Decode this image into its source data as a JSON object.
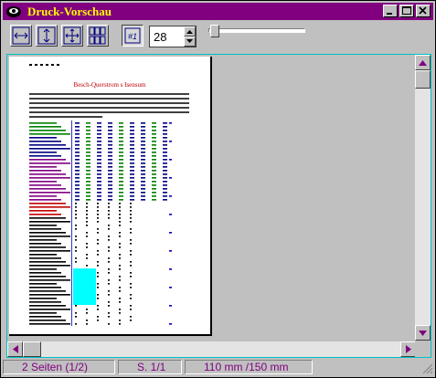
{
  "window": {
    "title": "Druck-Vorschau",
    "minimize": "_",
    "maximize": "□",
    "close": "✕"
  },
  "toolbar": {
    "buttons": [
      {
        "name": "fit-width-button",
        "icon": "fit-width-icon"
      },
      {
        "name": "fit-height-button",
        "icon": "fit-height-icon"
      },
      {
        "name": "fit-page-button",
        "icon": "fit-page-icon"
      },
      {
        "name": "multi-page-button",
        "icon": "grid-pages-icon"
      },
      {
        "name": "page-number-button",
        "icon": "page-number-icon",
        "label": "#1"
      }
    ],
    "zoom_value": "28",
    "slider_fraction": 0.05
  },
  "page": {
    "title": "Besch-Querstrom s Isensum",
    "intro_lines": 6,
    "highlight_color": "#00ffff"
  },
  "status": {
    "pages": "2 Seiten (1/2)",
    "current": "S. 1/1",
    "size": "110 mm /150 mm"
  },
  "colors": {
    "titlebar": "#800080",
    "title_text": "#ffff00",
    "status_text": "#800080",
    "accent": "#00c0c0"
  }
}
